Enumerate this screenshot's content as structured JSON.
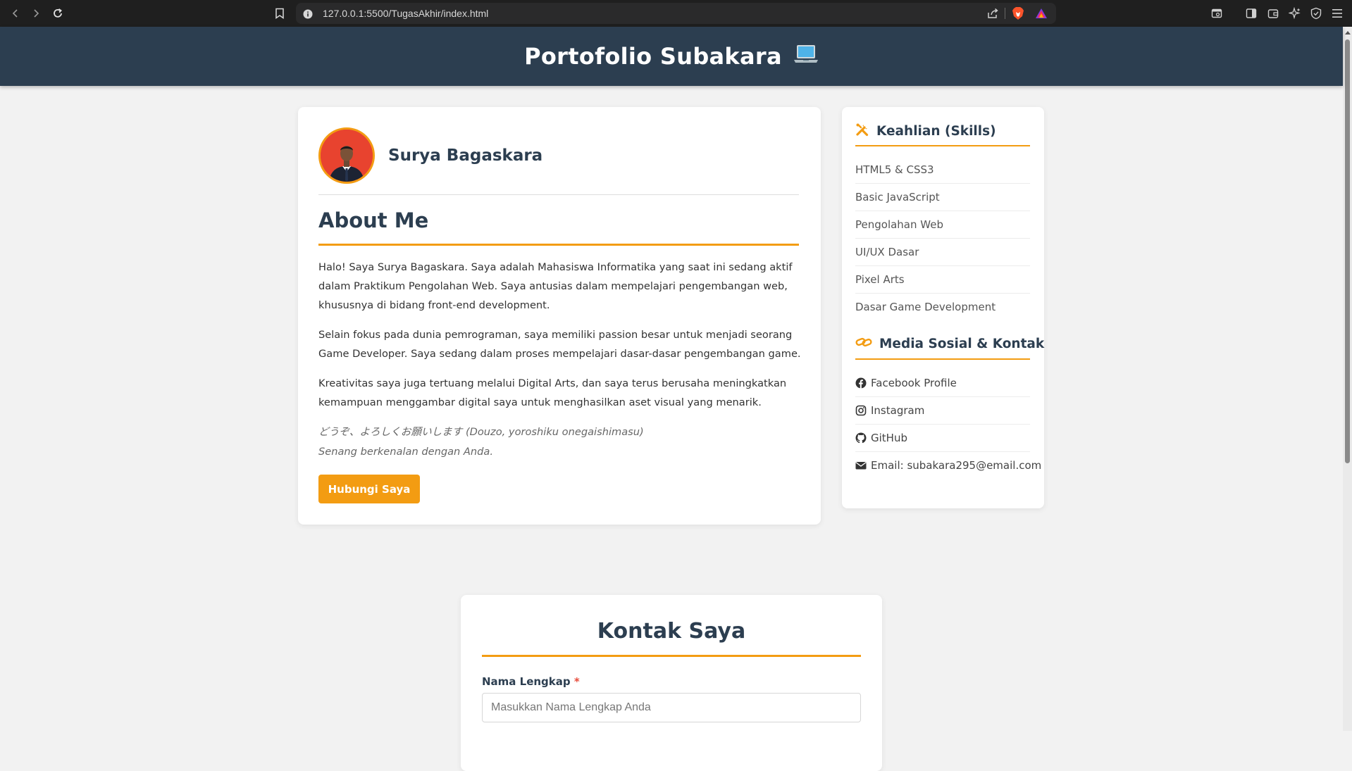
{
  "browser": {
    "url": "127.0.0.1:5500/TugasAkhir/index.html"
  },
  "header": {
    "title": "Portofolio Subakara",
    "emoji": "💻"
  },
  "profile": {
    "name": "Surya Bagaskara"
  },
  "about": {
    "title": "About Me",
    "paragraphs": [
      "Halo! Saya Surya Bagaskara. Saya adalah Mahasiswa Informatika yang saat ini sedang aktif dalam Praktikum Pengolahan Web. Saya antusias dalam mempelajari pengembangan web, khususnya di bidang front-end development.",
      "Selain fokus pada dunia pemrograman, saya memiliki passion besar untuk menjadi seorang Game Developer. Saya sedang dalam proses mempelajari dasar-dasar pengembangan game.",
      "Kreativitas saya juga tertuang melalui Digital Arts, dan saya terus berusaha meningkatkan kemampuan menggambar digital saya untuk menghasilkan aset visual yang menarik."
    ],
    "quote_line1": "どうぞ、よろしくお願いします (Douzo, yoroshiku onegaishimasu)",
    "quote_line2": "Senang berkenalan dengan Anda.",
    "button_label": "Hubungi Saya"
  },
  "skills": {
    "title": "Keahlian (Skills)",
    "items": [
      "HTML5 & CSS3",
      "Basic JavaScript",
      "Pengolahan Web",
      "UI/UX Dasar",
      "Pixel Arts",
      "Dasar Game Development"
    ]
  },
  "social": {
    "title": "Media Sosial & Kontak",
    "items": [
      {
        "label": "Facebook Profile",
        "icon": "facebook-icon"
      },
      {
        "label": "Instagram",
        "icon": "instagram-icon"
      },
      {
        "label": "GitHub",
        "icon": "github-icon"
      },
      {
        "label": "Email: subakara295@email.com",
        "icon": "envelope-icon"
      }
    ]
  },
  "contact": {
    "title": "Kontak Saya",
    "name_label": "Nama Lengkap",
    "required_mark": "*",
    "name_placeholder": "Masukkan Nama Lengkap Anda"
  },
  "colors": {
    "header_bg": "#2c3e50",
    "accent": "#f39c12",
    "page_bg": "#f2f2f2"
  }
}
